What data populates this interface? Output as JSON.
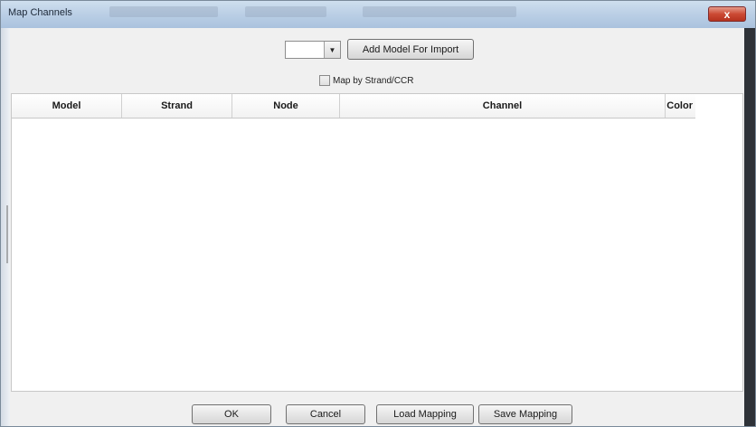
{
  "window": {
    "title": "Map Channels",
    "close_label": "x"
  },
  "toolbar": {
    "model_select_value": "",
    "add_model_label": "Add Model For Import",
    "map_by_strand_label": "Map by Strand/CCR",
    "map_by_strand_checked": false
  },
  "grid": {
    "columns": [
      "Model",
      "Strand",
      "Node",
      "Channel",
      "Color"
    ],
    "rows": []
  },
  "buttons": {
    "ok": "OK",
    "cancel": "Cancel",
    "load_mapping": "Load Mapping",
    "save_mapping": "Save Mapping"
  }
}
